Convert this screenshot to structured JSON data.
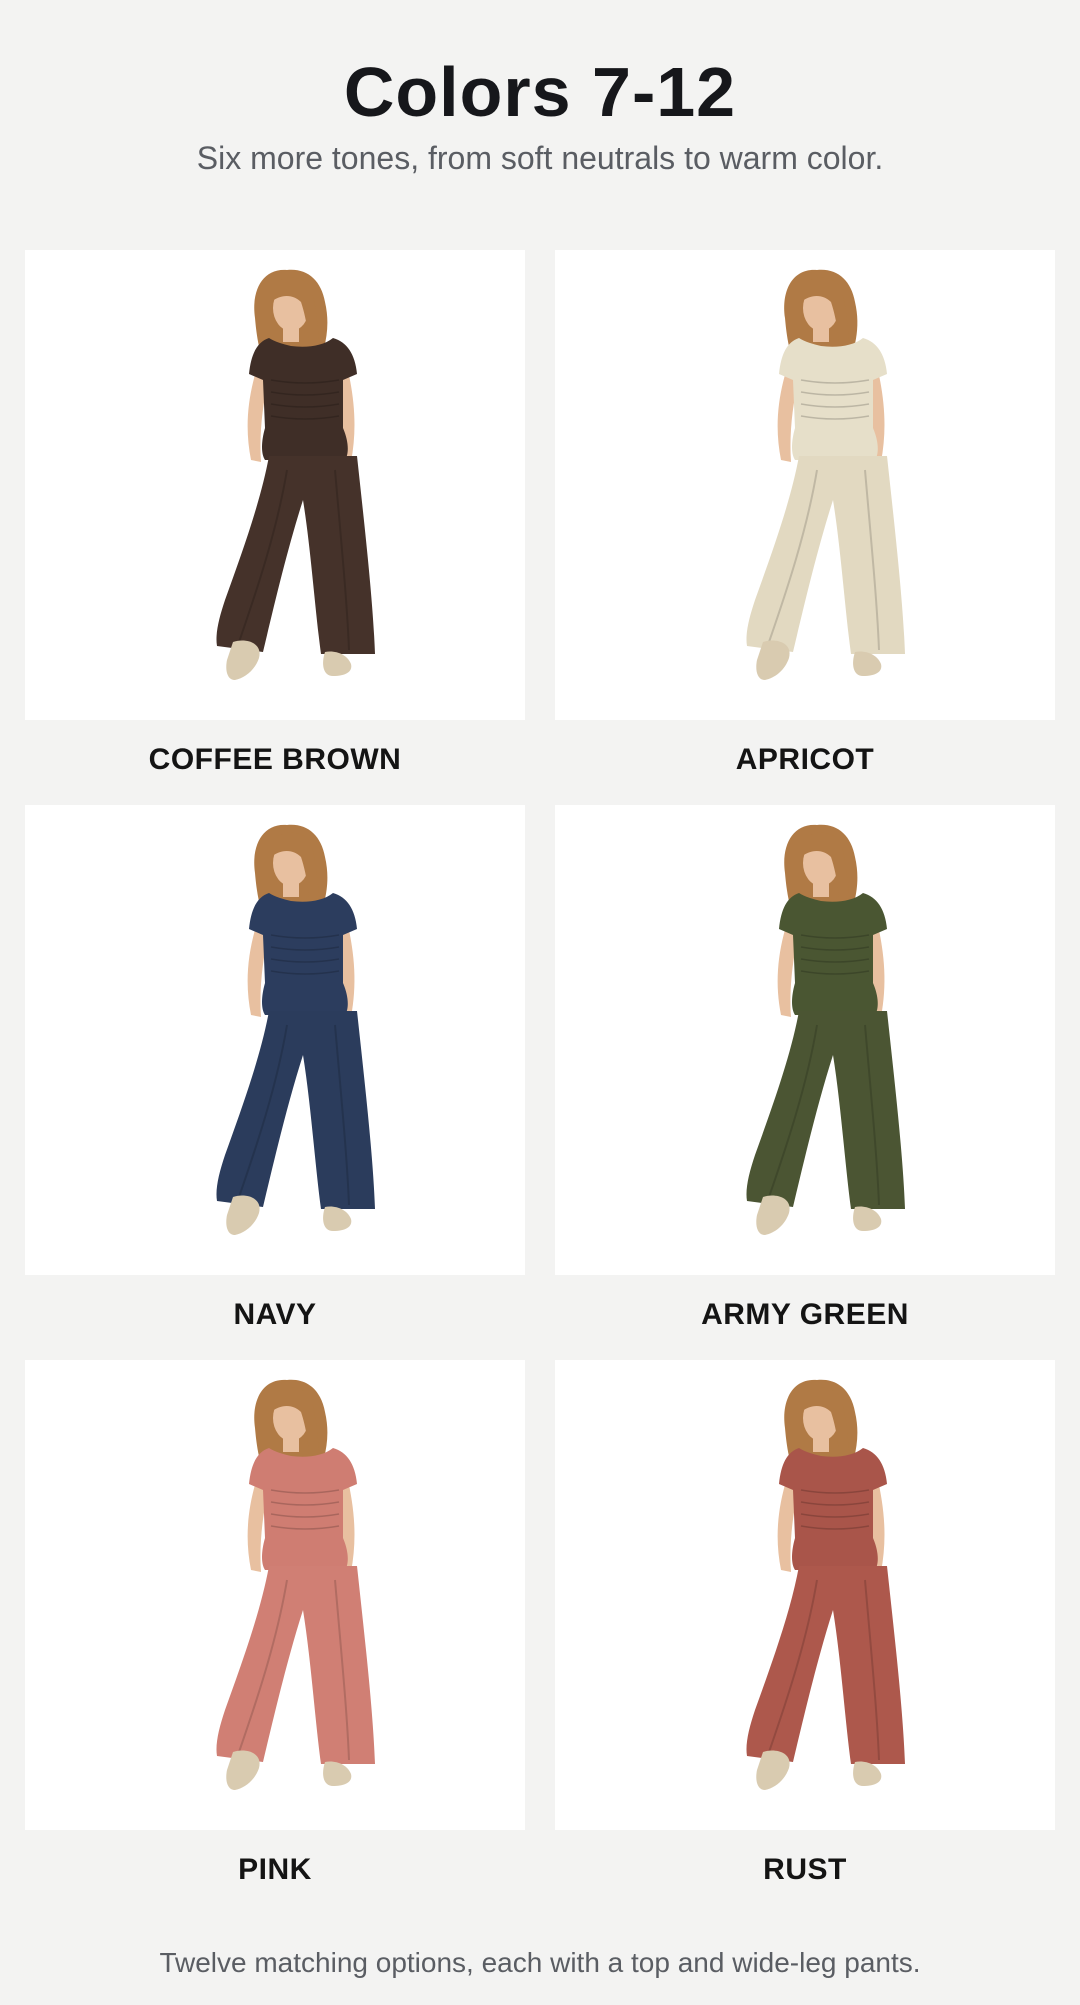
{
  "header": {
    "title": "Colors 7-12",
    "subtitle": "Six more tones, from soft neutrals to warm color."
  },
  "swatches": [
    {
      "name": "COFFEE BROWN",
      "top_color": "#3f2e27",
      "pants_color": "#45322a"
    },
    {
      "name": "APRICOT",
      "top_color": "#e6dfc9",
      "pants_color": "#e2d9c1"
    },
    {
      "name": "NAVY",
      "top_color": "#2c3d5e",
      "pants_color": "#2b3c5c"
    },
    {
      "name": "ARMY GREEN",
      "top_color": "#4a5632",
      "pants_color": "#4b5533"
    },
    {
      "name": "PINK",
      "top_color": "#cf7d72",
      "pants_color": "#d07f74"
    },
    {
      "name": "RUST",
      "top_color": "#a9554a",
      "pants_color": "#ad584c"
    }
  ],
  "footer": {
    "text": "Twelve matching options, each with a top and wide-leg pants."
  },
  "colors": {
    "background": "#f3f3f2",
    "card": "#ffffff",
    "title": "#16171b",
    "subtitle": "#5a5d63",
    "hair": "#b07a45",
    "skin": "#e8c0a0",
    "shoe": "#d9cbb0"
  }
}
